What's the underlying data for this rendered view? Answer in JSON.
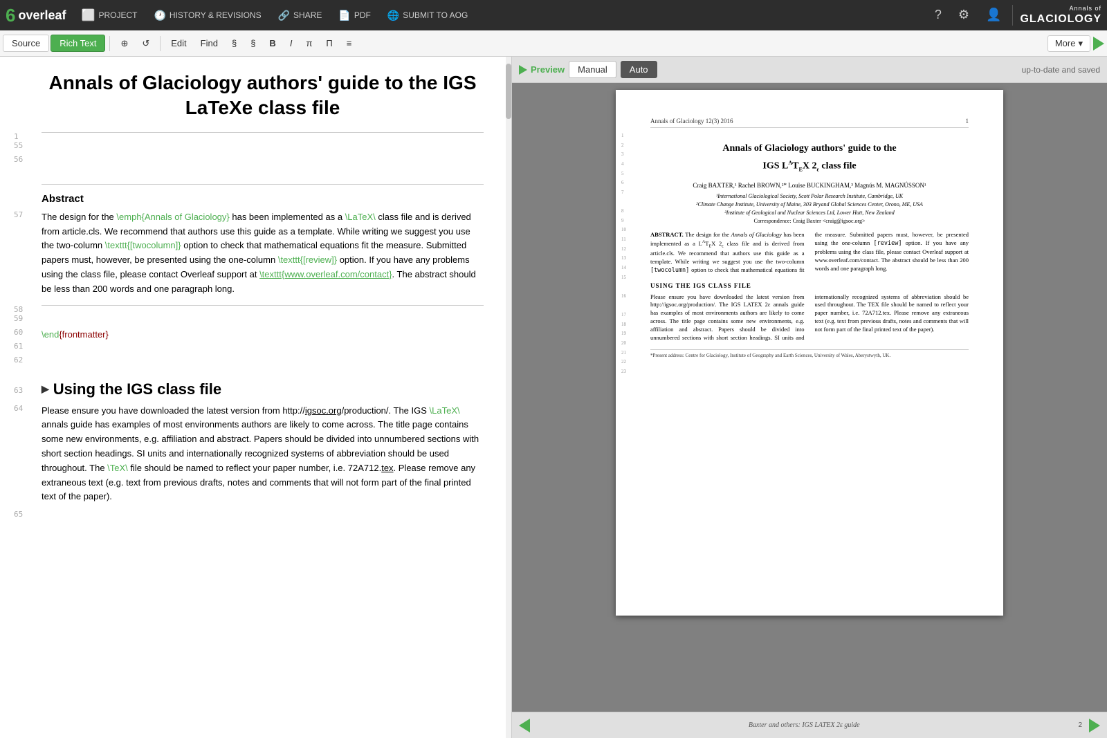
{
  "app": {
    "brand": "overleaf",
    "brand_six": "6",
    "brand_leaf": "overleaf"
  },
  "navbar": {
    "project_label": "PROJECT",
    "history_label": "HISTORY & REVISIONS",
    "share_label": "SHARE",
    "pdf_label": "PDF",
    "submit_label": "SUBMIT TO AOG"
  },
  "editor_toolbar": {
    "source_tab": "Source",
    "rich_text_tab": "Rich Text",
    "edit_btn": "Edit",
    "find_btn": "Find",
    "section_btn": "§",
    "section2_btn": "§",
    "bold_btn": "B",
    "italic_btn": "I",
    "pi_btn": "π",
    "table_btn": "П",
    "list_btn": "≡",
    "more_btn": "More"
  },
  "preview_toolbar": {
    "preview_label": "Preview",
    "manual_tab": "Manual",
    "auto_tab": "Auto",
    "status": "up-to-date and saved"
  },
  "editor_content": {
    "doc_title": "Annals of Glaciology authors' guide to the IGS LaTeXe class file",
    "abstract_heading": "Abstract",
    "line_numbers": [
      "1",
      "55",
      "56",
      "57",
      "58",
      "59",
      "60",
      "61",
      "62",
      "63",
      "64",
      "65"
    ],
    "abstract_text": "The design for the \\emph{Annals of Glaciology} has been implemented as a \\LaTeX\\ class file and is derived from article.cls. We recommend that authors use this guide as a template. While writing we suggest you use the two-column \\texttt{[twocolumn]} option to check that mathematical equations fit the measure. Submitted papers must, however, be presented using the one-column \\texttt{[review]} option. If you have any problems using the class file, please contact Overleaf support at \\texttt{www.overleaf.com/contact}. The abstract should be less than 200 words and one paragraph long.",
    "end_cmd": "\\end{frontmatter}",
    "section2_title": "Using the IGS class file",
    "section2_text": "Please ensure you have downloaded the latest version from http://igsoc.org/production/. The IGS \\LaTeX\\ annals guide has examples of most environments authors are likely to come across. The title page contains some new environments, e.g. affiliation and abstract. Papers should be divided into unnumbered sections with short section headings. SI units and internationally recognized systems of abbreviation should be used throughout. The \\TeX\\ file should be named to reflect your paper number, i.e. 72A712.tex. Please remove any extraneous text (e.g. text from previous drafts, notes and comments that will not form part of the final printed text of the paper)."
  },
  "pdf_page": {
    "header_left": "Annals of Glaciology 12(3) 2016",
    "header_right": "1",
    "title_line1": "Annals of Glaciology authors' guide to the",
    "title_line2": "IGS LATEX 2ε class file",
    "authors": "Craig BAXTER,¹ Rachel BROWN,²* Louise BUCKINGHAM,³ Magnús M. MAGNÚSSON¹",
    "affil1": "¹International Glaciological Society, Scott Polar Research Institute, Cambridge, UK",
    "affil2": "²Climate Change Institute, University of Maine, 303 Bryand Global Sciences Center, Orono, ME, USA",
    "affil3": "³Institute of Geological and Nuclear Sciences Ltd, Lower Hutt, New Zealand",
    "corr": "Correspondence: Craig Baxter <craig@igsoc.org>",
    "abstract_text": "ABSTRACT. The design for the Annals of Glaciology has been implemented as a LATEX 2ε class file and is derived from article.cls. We recommend that authors use this guide as a template. While writing we suggest you use the two-column [twocolumn] option to check that mathematical equations fit the measure. Submitted papers must, however, be presented using the one-column [review] option. If you have any problems using the class file, please contact Overleaf support at www.overleaf.com/contact. The abstract should be less than 200 words and one paragraph long.",
    "section_title": "USING THE IGS CLASS FILE",
    "body_text": "Please ensure you have downloaded the latest version from http://igsoc.org/production/. The IGS LATEX 2ε annals guide has examples of most environments authors are likely to come across. The title page contains some new environments, e.g. affiliation and abstract. Papers should be divided into unnumbered sections with short section headings. SI units and internationally recognized systems of abbreviation should be used throughout. The TEX file should be named to reflect your paper number, i.e. 72A712.tex. Please remove any extraneous text (e.g. text from previous drafts, notes and comments that will not form part of the final printed text of the paper).",
    "footnote": "*Present address: Centre for Glaciology, Institute of Geography and Earth Sciences, University of Wales, Aberystwyth, UK.",
    "footer_left": "Baxter and others: IGS LATEX 2ε guide",
    "footer_right": "2"
  }
}
